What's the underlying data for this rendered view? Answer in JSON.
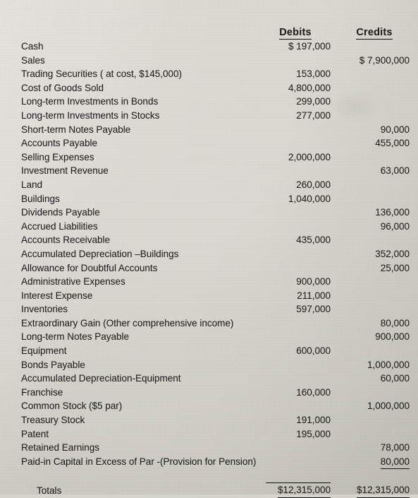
{
  "document": {
    "type": "trial-balance",
    "columns": {
      "account_header": "",
      "debits_header": "Debits",
      "credits_header": "Credits"
    },
    "rows": [
      {
        "account": "Cash",
        "debit": "$ 197,000",
        "credit": ""
      },
      {
        "account": "Sales",
        "debit": "",
        "credit": "$ 7,900,000"
      },
      {
        "account": "Trading Securities ( at cost, $145,000)",
        "debit": "153,000",
        "credit": ""
      },
      {
        "account": "Cost of Goods Sold",
        "debit": "4,800,000",
        "credit": ""
      },
      {
        "account": "Long-term Investments in Bonds",
        "debit": "299,000",
        "credit": ""
      },
      {
        "account": "Long-term Investments in Stocks",
        "debit": "277,000",
        "credit": ""
      },
      {
        "account": "Short-term Notes Payable",
        "debit": "",
        "credit": "90,000"
      },
      {
        "account": "Accounts Payable",
        "debit": "",
        "credit": "455,000"
      },
      {
        "account": "Selling Expenses",
        "debit": "2,000,000",
        "credit": ""
      },
      {
        "account": "Investment Revenue",
        "debit": "",
        "credit": "63,000"
      },
      {
        "account": "Land",
        "debit": "260,000",
        "credit": ""
      },
      {
        "account": "Buildings",
        "debit": "1,040,000",
        "credit": ""
      },
      {
        "account": "Dividends Payable",
        "debit": "",
        "credit": "136,000"
      },
      {
        "account": "Accrued Liabilities",
        "debit": "",
        "credit": "96,000"
      },
      {
        "account": "Accounts Receivable",
        "debit": "435,000",
        "credit": ""
      },
      {
        "account": "Accumulated Depreciation –Buildings",
        "debit": "",
        "credit": "352,000"
      },
      {
        "account": "Allowance for Doubtful Accounts",
        "debit": "",
        "credit": "25,000"
      },
      {
        "account": "Administrative Expenses",
        "debit": "900,000",
        "credit": ""
      },
      {
        "account": "Interest Expense",
        "debit": "211,000",
        "credit": ""
      },
      {
        "account": "Inventories",
        "debit": "597,000",
        "credit": ""
      },
      {
        "account": "Extraordinary Gain (Other comprehensive income)",
        "debit": "",
        "credit": "80,000"
      },
      {
        "account": "Long-term Notes Payable",
        "debit": "",
        "credit": "900,000"
      },
      {
        "account": "Equipment",
        "debit": "600,000",
        "credit": ""
      },
      {
        "account": "Bonds Payable",
        "debit": "",
        "credit": "1,000,000"
      },
      {
        "account": "Accumulated Depreciation-Equipment",
        "debit": "",
        "credit": "60,000"
      },
      {
        "account": "Franchise",
        "debit": "160,000",
        "credit": ""
      },
      {
        "account": "Common Stock ($5 par)",
        "debit": "",
        "credit": "1,000,000"
      },
      {
        "account": "Treasury Stock",
        "debit": "191,000",
        "credit": ""
      },
      {
        "account": "Patent",
        "debit": "195,000",
        "credit": ""
      },
      {
        "account": "Retained Earnings",
        "debit": "",
        "credit": "78,000"
      },
      {
        "account": "Paid-in Capital in Excess of Par -(Provision for Pension)",
        "debit": "",
        "credit": "80,000"
      }
    ],
    "totals": {
      "label": "Totals",
      "debit": "$12,315,000",
      "credit": "$12,315,000"
    },
    "colors": {
      "paper": "#d6d3cc",
      "ink": "#1d1d1d",
      "rule": "#141414"
    }
  }
}
